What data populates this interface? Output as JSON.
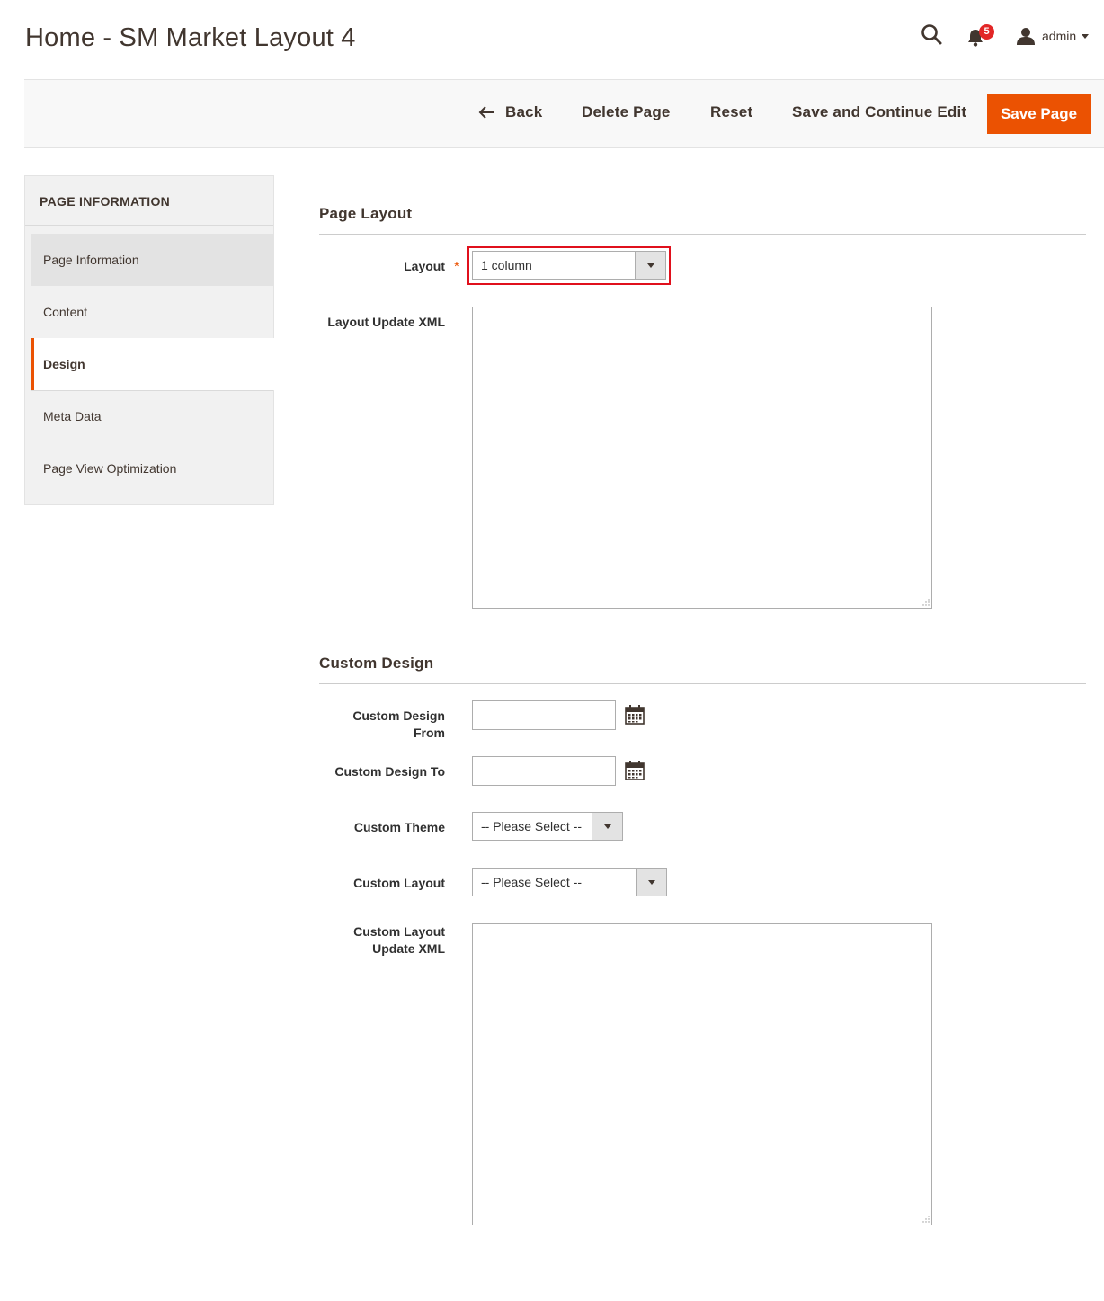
{
  "header": {
    "title": "Home - SM Market Layout 4",
    "notification_count": "5",
    "user_name": "admin"
  },
  "toolbar": {
    "back_label": "Back",
    "delete_label": "Delete Page",
    "reset_label": "Reset",
    "save_continue_label": "Save and Continue Edit",
    "save_label": "Save Page"
  },
  "sidebar": {
    "title": "PAGE INFORMATION",
    "items": [
      {
        "label": "Page Information"
      },
      {
        "label": "Content"
      },
      {
        "label": "Design"
      },
      {
        "label": "Meta Data"
      },
      {
        "label": "Page View Optimization"
      }
    ]
  },
  "page_layout": {
    "section_title": "Page Layout",
    "layout_label": "Layout",
    "layout_required_mark": "*",
    "layout_value": "1 column",
    "layout_xml_label": "Layout Update XML",
    "layout_xml_value": ""
  },
  "custom_design": {
    "section_title": "Custom Design",
    "from_label": "Custom Design From",
    "from_value": "",
    "to_label": "Custom Design To",
    "to_value": "",
    "theme_label": "Custom Theme",
    "theme_value": "-- Please Select --",
    "layout_label": "Custom Layout",
    "layout_value": "-- Please Select --",
    "xml_label_line1": "Custom Layout",
    "xml_label_line2": "Update XML",
    "xml_value": ""
  },
  "colors": {
    "accent": "#eb5202",
    "highlight": "#e0101c",
    "badge": "#e22626"
  }
}
